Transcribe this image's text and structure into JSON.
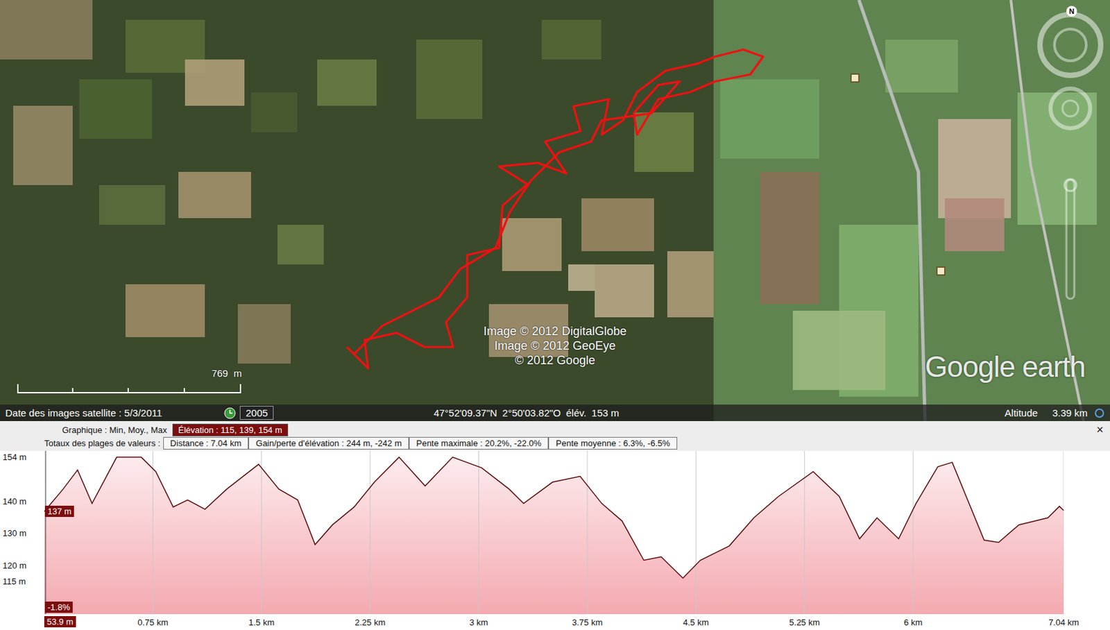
{
  "map": {
    "copyright": [
      "Image © 2012 DigitalGlobe",
      "Image © 2012 GeoEye",
      "© 2012 Google"
    ],
    "scale": "769  m",
    "logo": "Google earth",
    "compass": "N",
    "status_bar": {
      "imagery_date": "Date des images satellite : 5/3/2011",
      "history_year": "2005",
      "latitude": "47°52'09.37\"N",
      "longitude": "2°50'03.82\"O",
      "elevation_label": "élév.",
      "elevation": "153 m",
      "altitude_label": "Altitude",
      "altitude": "3.39 km"
    }
  },
  "chart": {
    "graph_label": "Graphique : Min, Moy., Max",
    "series_stat": {
      "label": "Élévation : 115, 139, 154 m",
      "selected": true
    },
    "totals_label": "Totaux des plages de valeurs :",
    "totals": [
      "Distance : 7.04 km",
      "Gain/perte d'élévation : 244 m, -242 m",
      "Pente maximale : 20.2%, -22.0%",
      "Pente moyenne : 6.3%, -6.5%"
    ],
    "close": "×",
    "y_ticks": [
      {
        "label": "154 m",
        "value": 154
      },
      {
        "label": "140 m",
        "value": 140
      },
      {
        "label": "130 m",
        "value": 130
      },
      {
        "label": "120 m",
        "value": 120
      },
      {
        "label": "115 m",
        "value": 115
      }
    ],
    "x_ticks": [
      {
        "label": "0.75 km",
        "value": 0.75
      },
      {
        "label": "1.5 km",
        "value": 1.5
      },
      {
        "label": "2.25 km",
        "value": 2.25
      },
      {
        "label": "3 km",
        "value": 3
      },
      {
        "label": "3.75 km",
        "value": 3.75
      },
      {
        "label": "4.5 km",
        "value": 4.5
      },
      {
        "label": "5.25 km",
        "value": 5.25
      },
      {
        "label": "6 km",
        "value": 6
      },
      {
        "label": "7.04 km",
        "value": 7.04
      }
    ],
    "cursor": {
      "elevation": "137 m",
      "slope": "-1.8%",
      "distance": "53.9 m"
    },
    "profile": {
      "distance_km": [
        0,
        0.13,
        0.23,
        0.33,
        0.5,
        0.67,
        0.77,
        0.89,
        0.99,
        1.11,
        1.26,
        1.48,
        1.62,
        1.75,
        1.87,
        1.99,
        2.14,
        2.28,
        2.45,
        2.63,
        2.82,
        3.02,
        3.21,
        3.31,
        3.51,
        3.7,
        3.85,
        3.99,
        4.14,
        4.26,
        4.41,
        4.53,
        4.73,
        4.9,
        5.07,
        5.31,
        5.49,
        5.63,
        5.75,
        5.9,
        6.02,
        6.17,
        6.27,
        6.49,
        6.59,
        6.73,
        6.93,
        7.01,
        7.04
      ],
      "elevation_m": [
        137,
        144,
        150,
        139.5,
        154,
        154,
        149.5,
        138.4,
        140.6,
        137.7,
        144,
        151.8,
        144,
        140.6,
        126.6,
        132.8,
        138.4,
        146.2,
        154,
        145,
        154,
        150.7,
        144,
        139.5,
        146.2,
        148,
        139.5,
        134,
        121.7,
        122.8,
        116.1,
        121.7,
        126.2,
        135,
        141.7,
        149.5,
        141.7,
        128.4,
        135,
        128.4,
        139.5,
        151,
        152.4,
        128,
        127.3,
        132.8,
        135,
        138.6,
        137.3
      ]
    }
  }
}
